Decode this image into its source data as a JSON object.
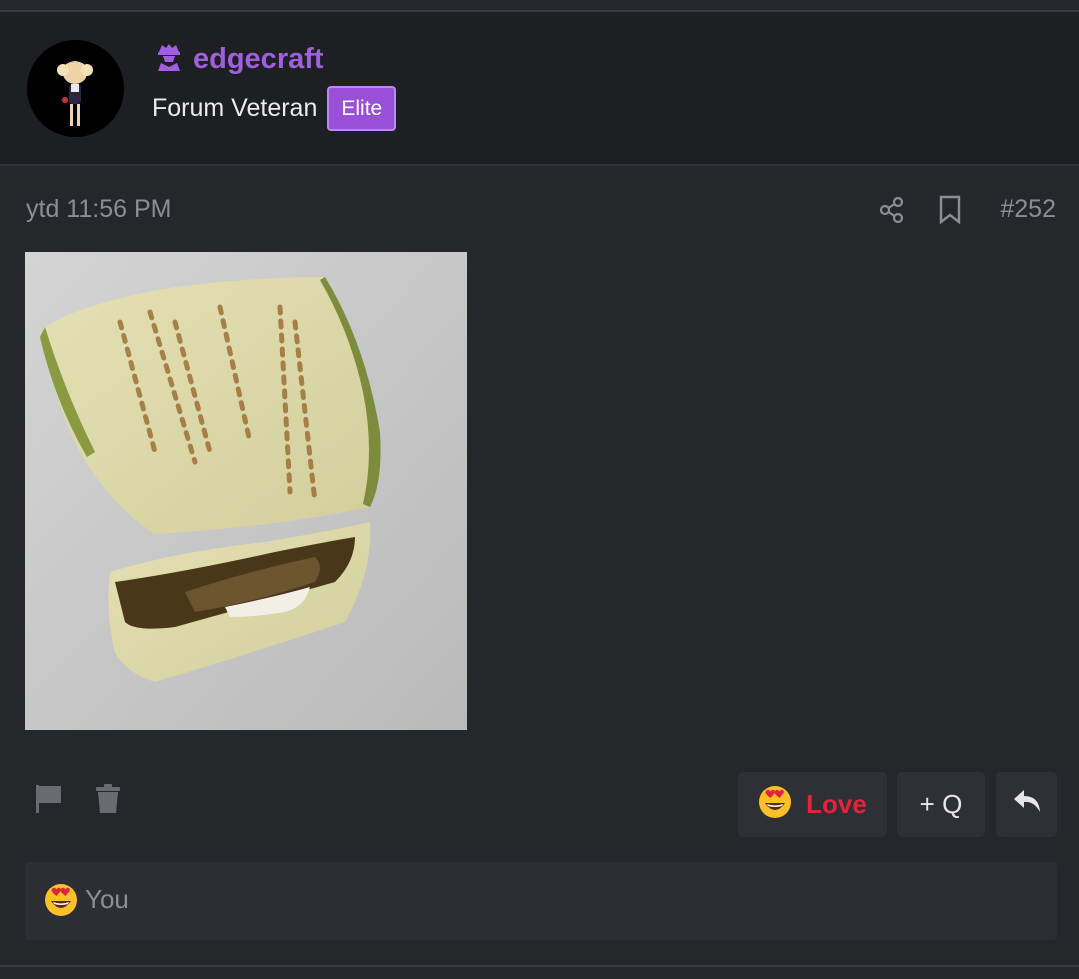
{
  "user": {
    "username": "edgecraft",
    "title": "Forum Veteran",
    "badge": "Elite",
    "accent_color": "#a15fe0"
  },
  "post": {
    "time": "ytd 11:56 PM",
    "number": "#252",
    "image_alt": "eggplant"
  },
  "actions": {
    "love_label": "Love",
    "quote_label": "+ Q",
    "icons": [
      "flag-icon",
      "trash-icon",
      "share-icon",
      "bookmark-icon",
      "reply-icon"
    ]
  },
  "reactions": {
    "users": "You",
    "emoji": "heart-eyes"
  }
}
